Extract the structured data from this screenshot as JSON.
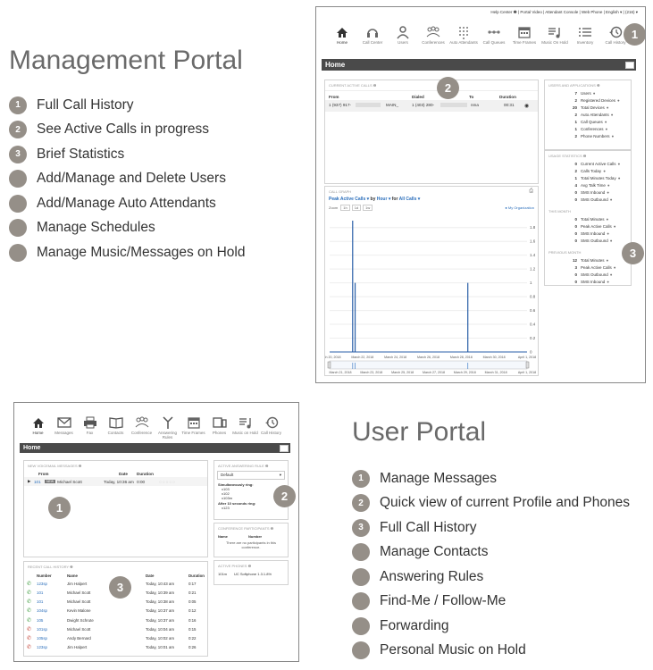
{
  "management": {
    "title": "Management Portal",
    "features": [
      {
        "n": "1",
        "label": "Full Call History"
      },
      {
        "n": "2",
        "label": "See Active Calls in progress"
      },
      {
        "n": "3",
        "label": "Brief Statistics"
      },
      {
        "n": "",
        "label": "Add/Manage and Delete Users"
      },
      {
        "n": "",
        "label": "Add/Manage Auto Attendants"
      },
      {
        "n": "",
        "label": "Manage Schedules"
      },
      {
        "n": "",
        "label": "Manage Music/Messages on Hold"
      }
    ]
  },
  "user": {
    "title": "User Portal",
    "features": [
      {
        "n": "1",
        "label": "Manage Messages"
      },
      {
        "n": "2",
        "label": "Quick view of current Profile and Phones"
      },
      {
        "n": "3",
        "label": "Full Call History"
      },
      {
        "n": "",
        "label": "Manage Contacts"
      },
      {
        "n": "",
        "label": "Answering Rules"
      },
      {
        "n": "",
        "label": "Find-Me / Follow-Me"
      },
      {
        "n": "",
        "label": "Forwarding"
      },
      {
        "n": "",
        "label": "Personal Music on Hold"
      }
    ]
  },
  "mgmt_screen": {
    "topnav": "Help Center ❷  |  Portal Video  |  Attendant Console  |  Web Phone  |  English ▾  |  (216) ▾",
    "nav": [
      {
        "icon": "home-icon",
        "label": "Home"
      },
      {
        "icon": "headset-icon",
        "label": "Call Center"
      },
      {
        "icon": "user-icon",
        "label": "Users"
      },
      {
        "icon": "conference-icon",
        "label": "Conferences"
      },
      {
        "icon": "dialpad-icon",
        "label": "Auto Attendants"
      },
      {
        "icon": "queue-icon",
        "label": "Call Queues"
      },
      {
        "icon": "calendar-icon",
        "label": "Time Frames"
      },
      {
        "icon": "music-icon",
        "label": "Music On Hold"
      },
      {
        "icon": "list-icon",
        "label": "Inventory"
      },
      {
        "icon": "history-icon",
        "label": "Call History"
      }
    ],
    "page_title": "Home",
    "active_calls": {
      "heading": "CURRENT ACTIVE CALLS ❷",
      "cols": [
        "From",
        "Dialed",
        "To",
        "Duration"
      ],
      "row": [
        "1 (937) 917-",
        "MAIN_",
        "1 (403) 280-",
        "nma",
        "00:31"
      ]
    },
    "call_graph": {
      "heading": "CALL GRAPH",
      "selector_a": "Peak Active Calls ▾",
      "by": "by",
      "selector_b": "Hour ▾",
      "for": "for",
      "selector_c": "All Calls ▾",
      "zoom": "Zoom",
      "zoom_opts": [
        "1h",
        "1d",
        "1w"
      ],
      "legend": "My Organization"
    },
    "users_apps": {
      "heading": "USERS AND APPLICATIONS ❷",
      "rows": [
        [
          "7",
          "Users"
        ],
        [
          "2",
          "Registered Devices"
        ],
        [
          "20",
          "Total Devices"
        ],
        [
          "2",
          "Auto Attendants"
        ],
        [
          "1",
          "Call Queues"
        ],
        [
          "1",
          "Conferences"
        ],
        [
          "2",
          "Phone Numbers"
        ]
      ]
    },
    "usage_today": {
      "heading": "USAGE STATISTICS ❷",
      "rows": [
        [
          "0",
          "Current Active Calls"
        ],
        [
          "2",
          "Calls Today"
        ],
        [
          "1",
          "Total Minutes Today"
        ],
        [
          "4",
          "Avg Talk Time"
        ],
        [
          "0",
          "SMS Inbound"
        ],
        [
          "0",
          "SMS Outbound"
        ]
      ]
    },
    "this_month": {
      "heading": "THIS MONTH",
      "rows": [
        [
          "0",
          "Total Minutes"
        ],
        [
          "0",
          "Peak Active Calls"
        ],
        [
          "0",
          "SMS Inbound"
        ],
        [
          "0",
          "SMS Outbound"
        ]
      ]
    },
    "prev_month": {
      "heading": "PREVIOUS MONTH",
      "rows": [
        [
          "12",
          "Total Minutes"
        ],
        [
          "3",
          "Peak Active Calls"
        ],
        [
          "0",
          "SMS Outbound"
        ],
        [
          "0",
          "SMS Inbound"
        ]
      ]
    },
    "badges": [
      "1",
      "2",
      "3"
    ]
  },
  "user_screen": {
    "nav": [
      {
        "icon": "home-icon",
        "label": "Home"
      },
      {
        "icon": "mail-icon",
        "label": "Messages"
      },
      {
        "icon": "fax-icon",
        "label": "Fax"
      },
      {
        "icon": "contacts-icon",
        "label": "Contacts"
      },
      {
        "icon": "conference-icon",
        "label": "Conference"
      },
      {
        "icon": "rules-icon",
        "label": "Answering Rules"
      },
      {
        "icon": "calendar-icon",
        "label": "Time Frames"
      },
      {
        "icon": "phones-icon",
        "label": "Phones"
      },
      {
        "icon": "music-icon",
        "label": "Music on Hold"
      },
      {
        "icon": "history-icon",
        "label": "Call History"
      }
    ],
    "page_title": "Home",
    "voicemail": {
      "heading": "NEW VOICEMAIL MESSAGES ❷",
      "cols": [
        "From",
        "Date",
        "Duration"
      ],
      "row": [
        "101",
        "Michael Scott",
        "Today, 10:36 am",
        "0:00"
      ]
    },
    "answering": {
      "heading": "ACTIVE ANSWERING RULE ❷",
      "select": "Default",
      "sim": "Simultaneously ring:",
      "sim_list": [
        "x103",
        "x102",
        "x103m"
      ],
      "after": "After 10 seconds ring:",
      "after_list": [
        "x123"
      ]
    },
    "conference": {
      "heading": "CONFERENCE PARTICIPANTS ❷",
      "cols": [
        "Name",
        "Number"
      ],
      "empty": "There are no participants in this conference."
    },
    "phones": {
      "heading": "ACTIVE PHONES ❷",
      "row": [
        "101m",
        "UC Softphone 1.3.1.8%"
      ]
    },
    "history": {
      "heading": "RECENT CALL HISTORY ❷",
      "cols": [
        "Number",
        "Name",
        "Date",
        "Duration"
      ],
      "rows": [
        {
          "dir": "in",
          "num": "123sp",
          "name": "Jim Halpert",
          "date": "Today, 10:43 am",
          "dur": "0:17"
        },
        {
          "dir": "in",
          "num": "101",
          "name": "Michael Scott",
          "date": "Today, 10:39 am",
          "dur": "0:21"
        },
        {
          "dir": "in",
          "num": "101",
          "name": "Michael Scott",
          "date": "Today, 10:38 am",
          "dur": "0:05"
        },
        {
          "dir": "in",
          "num": "104sp",
          "name": "Kevin Malone",
          "date": "Today, 10:37 am",
          "dur": "0:12"
        },
        {
          "dir": "in",
          "num": "105",
          "name": "Dwight Schrute",
          "date": "Today, 10:37 am",
          "dur": "0:16"
        },
        {
          "dir": "out",
          "num": "101sp",
          "name": "Michael Scott",
          "date": "Today, 10:04 am",
          "dur": "0:15"
        },
        {
          "dir": "out",
          "num": "105sp",
          "name": "Andy Bernard",
          "date": "Today, 10:02 am",
          "dur": "0:22"
        },
        {
          "dir": "out",
          "num": "123sp",
          "name": "Jim Halpert",
          "date": "Today, 10:01 am",
          "dur": "0:26"
        }
      ]
    },
    "badges": [
      "1",
      "2",
      "3"
    ]
  },
  "chart_data": {
    "type": "line",
    "title": "",
    "x_ticks_top": [
      "March 20, 2018",
      "March 22, 2018",
      "March 24, 2018",
      "March 26, 2018",
      "March 28, 2018",
      "March 30, 2018",
      "April 1, 2018"
    ],
    "x_ticks_bottom": [
      "March 21, 2018",
      "March 23, 2018",
      "March 25, 2018",
      "March 27, 2018",
      "March 29, 2018",
      "March 31, 2018",
      "April 1, 2018"
    ],
    "y_ticks": [
      "0",
      "0.2",
      "0.4",
      "0.6",
      "0.8",
      "1",
      "1.2",
      "1.4",
      "1.6",
      "1.8"
    ],
    "ylim": [
      0,
      1.9
    ],
    "series": [
      {
        "x": [
          "Mar 21 09:00",
          "Mar 21 13:00",
          "Mar 28 10:00"
        ],
        "values": [
          1.9,
          1.0,
          1.0
        ]
      }
    ],
    "spike_positions_days": [
      1.4,
      1.55,
      8.4
    ],
    "x_range_days": [
      0,
      12
    ]
  }
}
